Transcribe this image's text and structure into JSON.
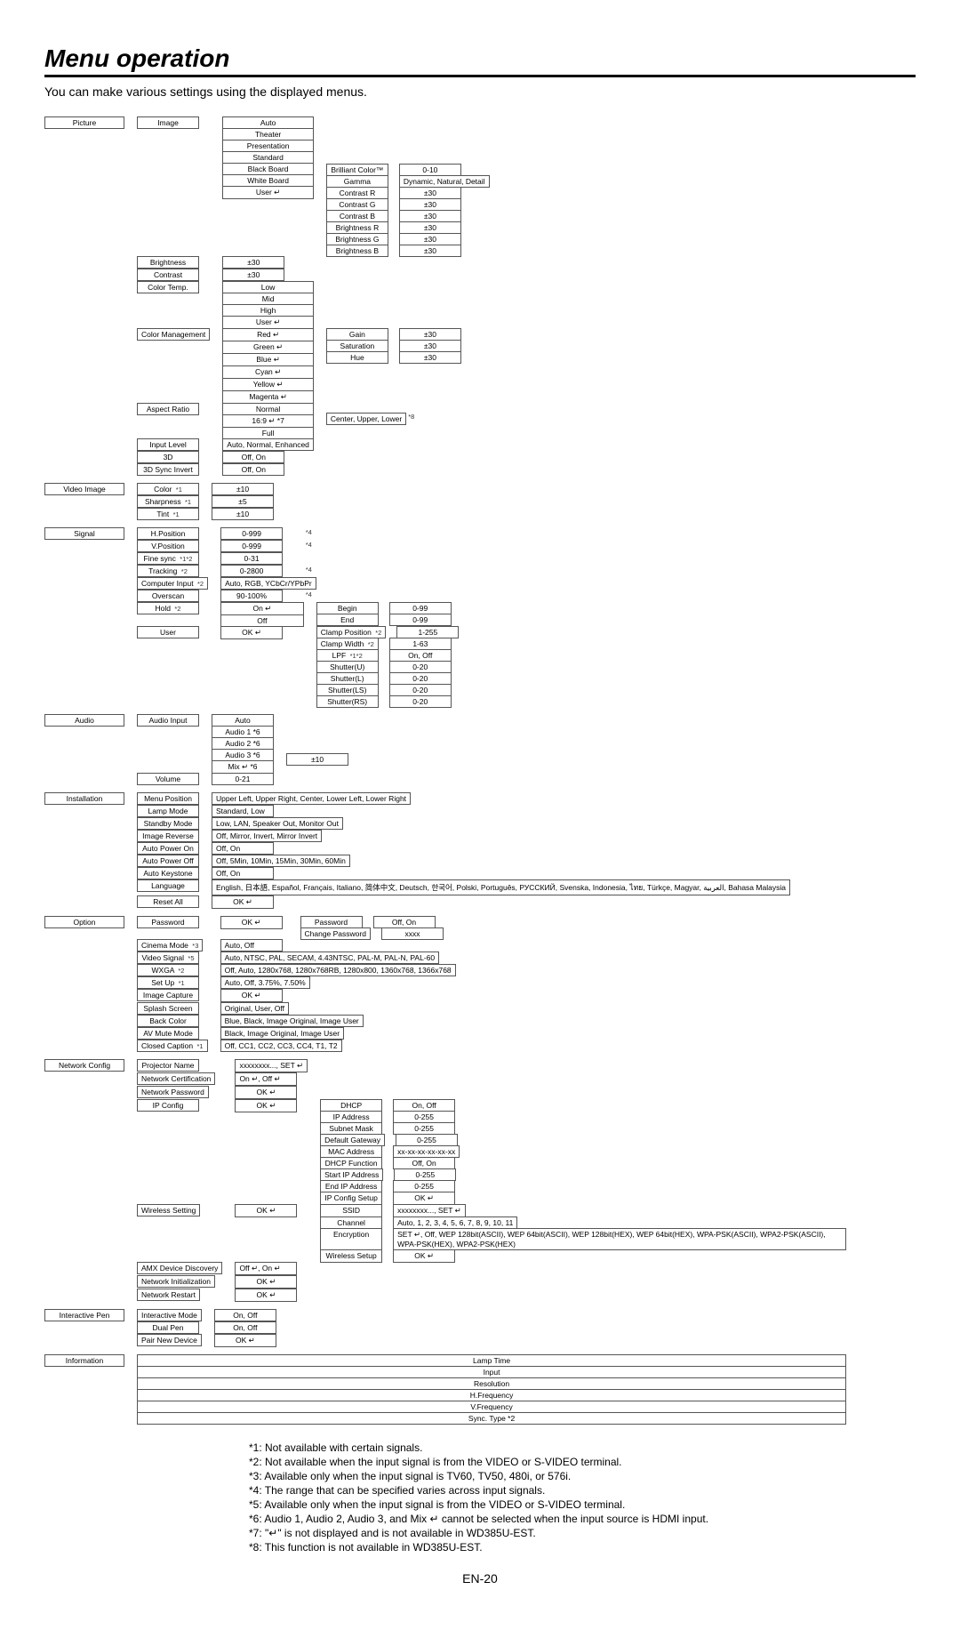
{
  "page": {
    "title": "Menu operation",
    "subtitle": "You can make various settings using the displayed menus.",
    "number": "EN-20"
  },
  "tree": {
    "picture": {
      "label": "Picture",
      "image": {
        "label": "Image",
        "opts": [
          "Auto",
          "Theater",
          "Presentation",
          "Standard",
          "Black Board",
          "White Board",
          "User ↵"
        ],
        "bc": {
          "label": "Brilliant Color™",
          "val": "0-10"
        },
        "gamma": {
          "label": "Gamma",
          "val": "Dynamic, Natural, Detail"
        },
        "cr": {
          "label": "Contrast R",
          "val": "±30"
        },
        "cg": {
          "label": "Contrast G",
          "val": "±30"
        },
        "cb": {
          "label": "Contrast B",
          "val": "±30"
        },
        "br": {
          "label": "Brightness R",
          "val": "±30"
        },
        "bg": {
          "label": "Brightness G",
          "val": "±30"
        },
        "bb": {
          "label": "Brightness B",
          "val": "±30"
        }
      },
      "brightness": {
        "label": "Brightness",
        "val": "±30"
      },
      "contrast": {
        "label": "Contrast",
        "val": "±30"
      },
      "ctemp": {
        "label": "Color Temp.",
        "opts": [
          "Low",
          "Mid",
          "High",
          "User ↵"
        ]
      },
      "cmgmt": {
        "label": "Color Management",
        "opts": [
          "Red ↵",
          "Green ↵",
          "Blue ↵",
          "Cyan ↵",
          "Yellow ↵",
          "Magenta ↵"
        ],
        "gain": {
          "label": "Gain",
          "val": "±30"
        },
        "sat": {
          "label": "Saturation",
          "val": "±30"
        },
        "hue": {
          "label": "Hue",
          "val": "±30"
        }
      },
      "aspect": {
        "label": "Aspect Ratio",
        "opts": [
          "Normal",
          "16:9 ↵ *7",
          "Full"
        ],
        "cul": "Center, Upper, Lower",
        "cul_note": "*8"
      },
      "input_level": {
        "label": "Input Level",
        "val": "Auto, Normal, Enhanced"
      },
      "threeD": {
        "label": "3D",
        "val": "Off, On"
      },
      "sync_inv": {
        "label": "3D Sync Invert",
        "val": "Off, On"
      }
    },
    "video_image": {
      "label": "Video Image",
      "color": {
        "label": "Color",
        "note": "*1",
        "val": "±10"
      },
      "sharp": {
        "label": "Sharpness",
        "note": "*1",
        "val": "±5"
      },
      "tint": {
        "label": "Tint",
        "note": "*1",
        "val": "±10"
      }
    },
    "signal": {
      "label": "Signal",
      "hpos": {
        "label": "H.Position",
        "val": "0-999",
        "note": "*4"
      },
      "vpos": {
        "label": "V.Position",
        "val": "0-999",
        "note": "*4"
      },
      "fsync": {
        "label": "Fine sync",
        "note": "*1*2",
        "val": "0-31"
      },
      "track": {
        "label": "Tracking",
        "note": "*2",
        "val": "0-2800",
        "note2": "*4"
      },
      "cinput": {
        "label": "Computer Input",
        "note": "*2",
        "val": "Auto, RGB, YCbCr/YPbPr"
      },
      "overscan": {
        "label": "Overscan",
        "val": "90-100%",
        "note": "*4"
      },
      "hold": {
        "label": "Hold",
        "note": "*2",
        "opts": [
          "On ↵",
          "Off"
        ],
        "begin": {
          "label": "Begin",
          "val": "0-99"
        },
        "end": {
          "label": "End",
          "val": "0-99"
        }
      },
      "user": {
        "label": "User",
        "val": "OK ↵",
        "cp": {
          "label": "Clamp Position",
          "note": "*2",
          "val": "1-255"
        },
        "cw": {
          "label": "Clamp Width",
          "note": "*2",
          "val": "1-63"
        },
        "lpf": {
          "label": "LPF",
          "note": "*1*2",
          "val": "On, Off"
        },
        "su": {
          "label": "Shutter(U)",
          "val": "0-20"
        },
        "sl": {
          "label": "Shutter(L)",
          "val": "0-20"
        },
        "sls": {
          "label": "Shutter(LS)",
          "val": "0-20"
        },
        "srs": {
          "label": "Shutter(RS)",
          "val": "0-20"
        }
      }
    },
    "audio": {
      "label": "Audio",
      "input": {
        "label": "Audio Input",
        "opts": [
          "Auto",
          "Audio 1 *6",
          "Audio 2 *6",
          "Audio 3 *6",
          "Mix ↵ *6"
        ],
        "mix_val": "±10"
      },
      "volume": {
        "label": "Volume",
        "val": "0-21"
      }
    },
    "installation": {
      "label": "Installation",
      "menupos": {
        "label": "Menu Position",
        "val": "Upper Left, Upper Right, Center, Lower Left, Lower Right"
      },
      "lamp": {
        "label": "Lamp Mode",
        "val": "Standard, Low"
      },
      "standby": {
        "label": "Standby Mode",
        "val": "Low, LAN, Speaker Out, Monitor Out"
      },
      "imgrev": {
        "label": "Image Reverse",
        "val": "Off, Mirror, Invert, Mirror Invert"
      },
      "apon": {
        "label": "Auto Power On",
        "val": "Off, On"
      },
      "apoff": {
        "label": "Auto Power Off",
        "val": "Off, 5Min, 10Min, 15Min, 30Min, 60Min"
      },
      "akey": {
        "label": "Auto Keystone",
        "val": "Off, On"
      },
      "lang": {
        "label": "Language",
        "val": "English, 日本語, Español, Français, Italiano, 简体中文, Deutsch, 한국어, Polski, Português, РУССКИЙ, Svenska, Indonesia, ไทย, Türkçe, Magyar, العربية, Bahasa Malaysia"
      },
      "reset": {
        "label": "Reset All",
        "val": "OK ↵"
      }
    },
    "option": {
      "label": "Option",
      "pwd": {
        "label": "Password",
        "val": "OK ↵",
        "p": {
          "label": "Password",
          "val": "Off, On"
        },
        "cp": {
          "label": "Change Password",
          "val": "xxxx"
        }
      },
      "cinema": {
        "label": "Cinema Mode",
        "note": "*3",
        "val": "Auto, Off"
      },
      "vsig": {
        "label": "Video Signal",
        "note": "*5",
        "val": "Auto, NTSC, PAL, SECAM, 4.43NTSC, PAL-M, PAL-N, PAL-60"
      },
      "wxga": {
        "label": "WXGA",
        "note": "*2",
        "val": "Off, Auto, 1280x768, 1280x768RB, 1280x800, 1360x768, 1366x768"
      },
      "setup": {
        "label": "Set Up",
        "note": "*1",
        "val": "Auto, Off, 3.75%, 7.50%"
      },
      "imgcap": {
        "label": "Image Capture",
        "val": "OK ↵"
      },
      "splash": {
        "label": "Splash Screen",
        "val": "Original, User, Off"
      },
      "back": {
        "label": "Back Color",
        "val": "Blue, Black, Image Original, Image User"
      },
      "avmute": {
        "label": "AV Mute Mode",
        "val": "Black, Image Original, Image User"
      },
      "cc": {
        "label": "Closed Caption",
        "note": "*1",
        "val": "Off, CC1, CC2, CC3, CC4, T1, T2"
      }
    },
    "network": {
      "label": "Network Config",
      "pname": {
        "label": "Projector Name",
        "val": "xxxxxxxx..., SET ↵"
      },
      "ncert": {
        "label": "Network Certification",
        "val": "On ↵, Off ↵"
      },
      "npwd": {
        "label": "Network Password",
        "val": "OK ↵"
      },
      "ipcfg": {
        "label": "IP Config",
        "val": "OK ↵",
        "dhcp": {
          "label": "DHCP",
          "val": "On, Off"
        },
        "ip": {
          "label": "IP Address",
          "val": "0-255"
        },
        "sm": {
          "label": "Subnet Mask",
          "val": "0-255"
        },
        "dg": {
          "label": "Default Gateway",
          "val": "0-255"
        },
        "mac": {
          "label": "MAC Address",
          "val": "xx-xx-xx-xx-xx-xx"
        },
        "dhcpf": {
          "label": "DHCP Function",
          "val": "Off, On"
        },
        "sip": {
          "label": "Start IP Address",
          "val": "0-255"
        },
        "eip": {
          "label": "End IP Address",
          "val": "0-255"
        },
        "setup": {
          "label": "IP Config Setup",
          "val": "OK ↵"
        }
      },
      "wireless": {
        "label": "Wireless Setting",
        "val": "OK ↵",
        "ssid": {
          "label": "SSID",
          "val": "xxxxxxxx..., SET ↵"
        },
        "ch": {
          "label": "Channel",
          "val": "Auto, 1, 2, 3, 4, 5, 6, 7, 8, 9, 10, 11"
        },
        "enc": {
          "label": "Encryption",
          "val": "SET ↵, Off,  WEP 128bit(ASCII), WEP 64bit(ASCII), WEP 128bit(HEX), WEP 64bit(HEX), WPA-PSK(ASCII), WPA2-PSK(ASCII), WPA-PSK(HEX), WPA2-PSK(HEX)"
        },
        "ws": {
          "label": "Wireless Setup",
          "val": "OK ↵"
        }
      },
      "amx": {
        "label": "AMX Device Discovery",
        "val": "Off ↵, On ↵"
      },
      "ninit": {
        "label": "Network Initialization",
        "val": "OK ↵"
      },
      "nrestart": {
        "label": "Network Restart",
        "val": "OK ↵"
      }
    },
    "ipen": {
      "label": "Interactive Pen",
      "imode": {
        "label": "Interactive Mode",
        "val": "On, Off"
      },
      "dual": {
        "label": "Dual Pen",
        "val": "On, Off"
      },
      "pair": {
        "label": "Pair New Device",
        "val": "OK ↵"
      }
    },
    "info": {
      "label": "Information",
      "items": [
        "Lamp Time",
        "Input",
        "Resolution",
        "H.Frequency",
        "V.Frequency",
        "Sync. Type    *2"
      ]
    }
  },
  "notes": {
    "n1": "*1: Not available with certain signals.",
    "n2": "*2: Not available when the input signal is from the VIDEO or S-VIDEO terminal.",
    "n3": "*3: Available only when the input signal is TV60, TV50, 480i, or 576i.",
    "n4": "*4: The range that can be specified varies across input signals.",
    "n5": "*5: Available only when the input signal is from the VIDEO or S-VIDEO terminal.",
    "n6": "*6: Audio 1, Audio 2, Audio 3, and Mix ↵ cannot be selected when the input source is HDMI input.",
    "n7": "*7: \"↵\" is not displayed and is not available in WD385U-EST.",
    "n8": "*8: This function is not available in WD385U-EST."
  }
}
